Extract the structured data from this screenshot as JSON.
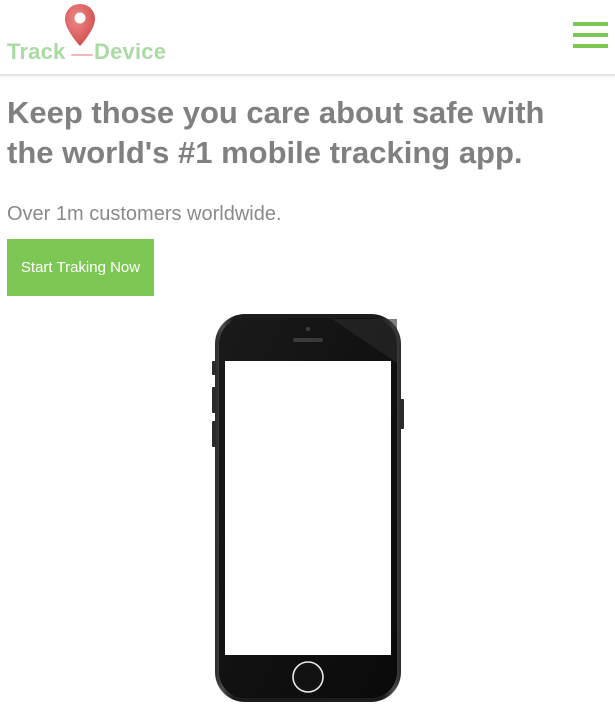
{
  "header": {
    "logo": {
      "left_word": "Track",
      "right_word": "Device",
      "icon": "map-pin-icon"
    },
    "menu_icon": "hamburger-menu-icon"
  },
  "hero": {
    "headline_line1": "Keep those you care about safe with",
    "headline_line2": "the world's #1 mobile tracking app.",
    "subline": "Over 1m customers worldwide.",
    "cta_label": "Start Traking Now",
    "device_image": "smartphone-mockup"
  },
  "colors": {
    "accent_green": "#7dc855",
    "logo_green": "#a9dba3",
    "pin_red": "#d9534f",
    "text_gray": "#808080"
  }
}
